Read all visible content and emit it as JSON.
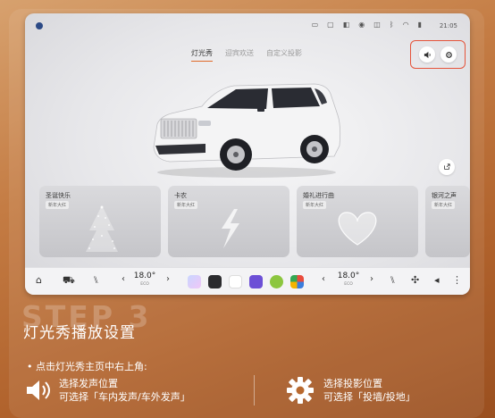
{
  "statusbar": {
    "time": "21:05"
  },
  "tabs": [
    {
      "label": "灯光秀"
    },
    {
      "label": "迎宾欢送"
    },
    {
      "label": "自定义投影"
    }
  ],
  "cards": [
    {
      "title": "圣诞快乐",
      "badge": "新年大红"
    },
    {
      "title": "卡农",
      "badge": "新年大红"
    },
    {
      "title": "婚礼进行曲",
      "badge": "新年大红"
    },
    {
      "title": "银河之声",
      "badge": "新年大红"
    }
  ],
  "dock": {
    "left_temp": {
      "value": "18.0°",
      "unit": "ECO"
    },
    "right_temp": {
      "value": "18.0°",
      "unit": "ECO"
    }
  },
  "overlay": {
    "step_label": "STEP 3",
    "heading": "灯光秀播放设置",
    "instruction": "• 点击灯光秀主页中右上角:",
    "sound_option": {
      "line1": "选择发声位置",
      "line2": "可选择「车内发声/车外发声」"
    },
    "projection_option": {
      "line1": "选择投影位置",
      "line2": "可选择「投墙/投地」"
    }
  },
  "colors": {
    "highlight": "#e5533a",
    "tab_underline": "#e06a2a"
  },
  "icons": [
    "speaker-icon",
    "gear-icon",
    "share-icon",
    "home-icon",
    "car-icon",
    "seat-icon",
    "fan-icon"
  ]
}
